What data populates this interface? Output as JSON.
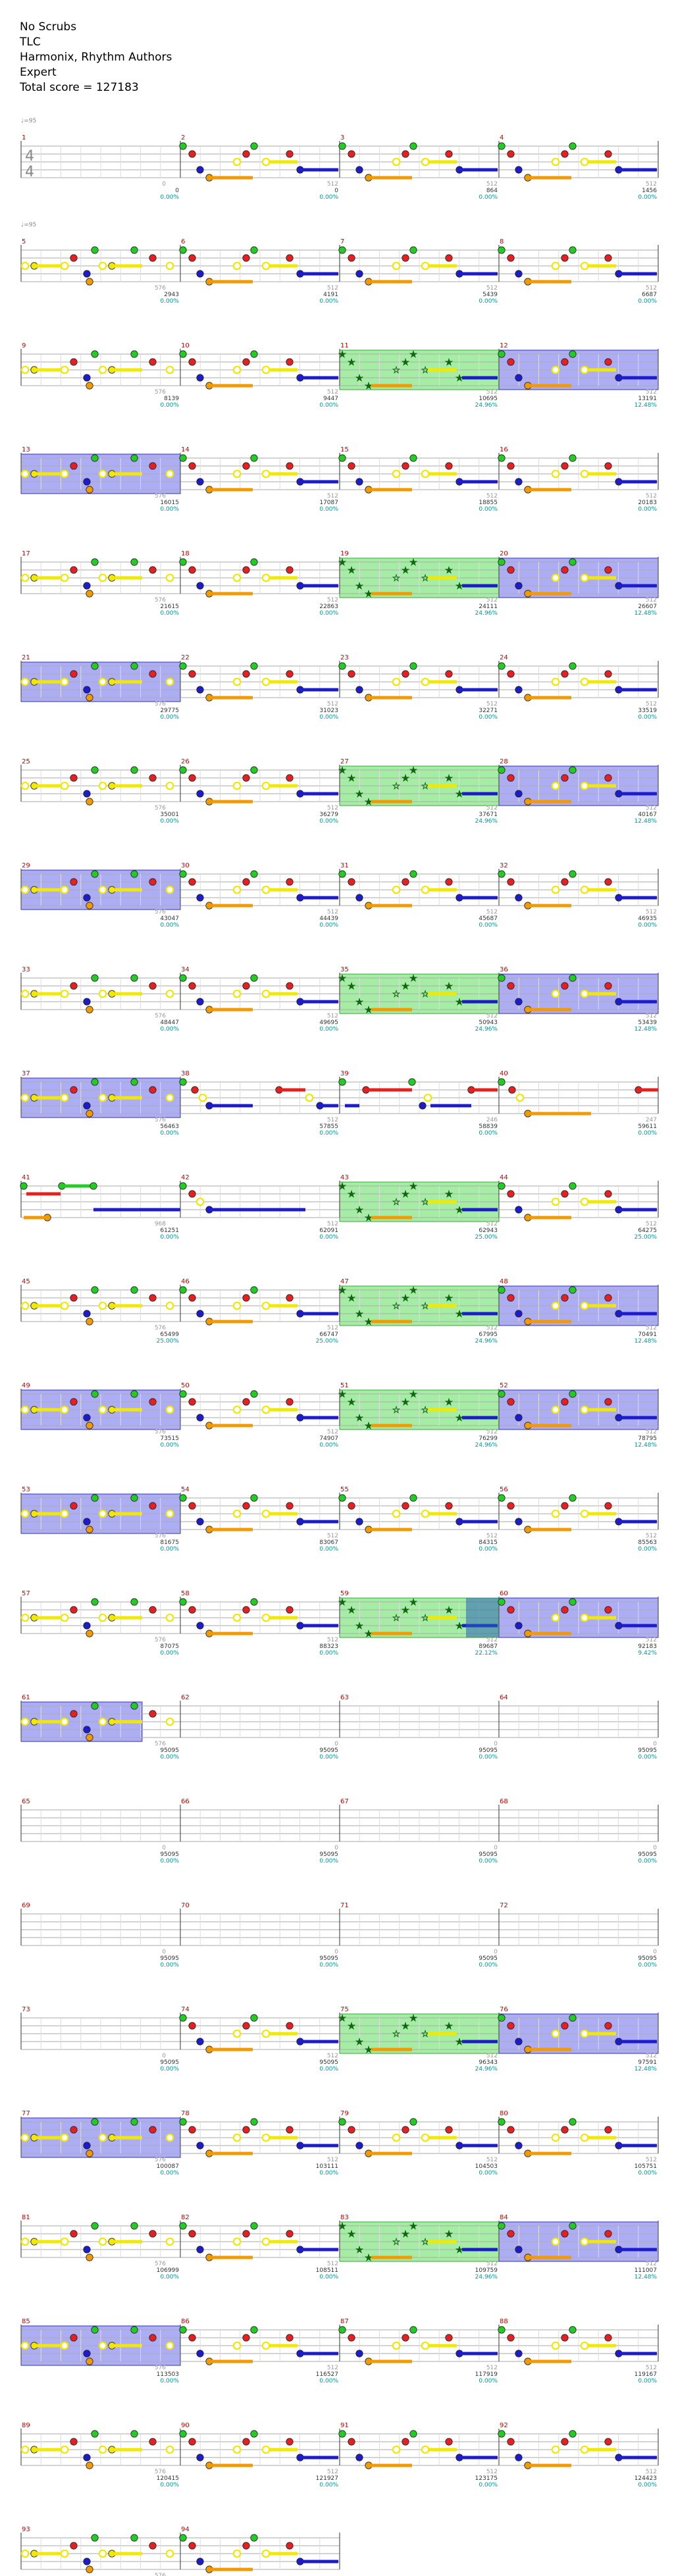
{
  "header": {
    "song_title": "No Scrubs",
    "artist": "TLC",
    "charter": "Harmonix, Rhythm Authors",
    "difficulty": "Expert",
    "total_score": "Total score = 127183"
  },
  "time_signature": "4/4",
  "tempo_markers": [
    {
      "measure": 1,
      "label": "♩=95"
    },
    {
      "measure": 5,
      "label": "♩=95"
    }
  ],
  "note_colors": {
    "green": "#22cc22",
    "red": "#e62020",
    "yellow": "#f2e800",
    "blue": "#1c1ccc",
    "orange": "#f29a00"
  },
  "measures": [
    {
      "n": 1,
      "score": "0",
      "pct": "0.00%",
      "mult": "0"
    },
    {
      "n": 2,
      "score": "0",
      "pct": "0.00%",
      "mult": "512"
    },
    {
      "n": 3,
      "score": "864",
      "pct": "0.00%",
      "mult": "512"
    },
    {
      "n": 4,
      "score": "1456",
      "pct": "0.00%",
      "mult": "512"
    },
    {
      "n": 5,
      "score": "2943",
      "pct": "0.00%",
      "mult": "576"
    },
    {
      "n": 6,
      "score": "4191",
      "pct": "0.00%",
      "mult": "512"
    },
    {
      "n": 7,
      "score": "5439",
      "pct": "0.00%",
      "mult": "512"
    },
    {
      "n": 8,
      "score": "6687",
      "pct": "0.00%",
      "mult": "512"
    },
    {
      "n": 9,
      "score": "8139",
      "pct": "0.00%",
      "mult": "576"
    },
    {
      "n": 10,
      "score": "9447",
      "pct": "0.00%",
      "mult": "512"
    },
    {
      "n": 11,
      "score": "10695",
      "pct": "24.96%",
      "mult": "512"
    },
    {
      "n": 12,
      "score": "13191",
      "pct": "12.48%",
      "mult": "512"
    },
    {
      "n": 13,
      "score": "16015",
      "pct": "0.00%",
      "mult": "576"
    },
    {
      "n": 14,
      "score": "17087",
      "pct": "0.00%",
      "mult": "512"
    },
    {
      "n": 15,
      "score": "18855",
      "pct": "0.00%",
      "mult": "512"
    },
    {
      "n": 16,
      "score": "20183",
      "pct": "0.00%",
      "mult": "512"
    },
    {
      "n": 17,
      "score": "21615",
      "pct": "0.00%",
      "mult": "576"
    },
    {
      "n": 18,
      "score": "22863",
      "pct": "0.00%",
      "mult": "512"
    },
    {
      "n": 19,
      "score": "24111",
      "pct": "24.96%",
      "mult": "512"
    },
    {
      "n": 20,
      "score": "26607",
      "pct": "12.48%",
      "mult": "512"
    },
    {
      "n": 21,
      "score": "29775",
      "pct": "0.00%",
      "mult": "576"
    },
    {
      "n": 22,
      "score": "31023",
      "pct": "0.00%",
      "mult": "512"
    },
    {
      "n": 23,
      "score": "32271",
      "pct": "0.00%",
      "mult": "512"
    },
    {
      "n": 24,
      "score": "33519",
      "pct": "0.00%",
      "mult": "512"
    },
    {
      "n": 25,
      "score": "35001",
      "pct": "0.00%",
      "mult": "576"
    },
    {
      "n": 26,
      "score": "36279",
      "pct": "0.00%",
      "mult": "512"
    },
    {
      "n": 27,
      "score": "37671",
      "pct": "24.96%",
      "mult": "512"
    },
    {
      "n": 28,
      "score": "40167",
      "pct": "12.48%",
      "mult": "512"
    },
    {
      "n": 29,
      "score": "43047",
      "pct": "0.00%",
      "mult": "576"
    },
    {
      "n": 30,
      "score": "44439",
      "pct": "0.00%",
      "mult": "512"
    },
    {
      "n": 31,
      "score": "45687",
      "pct": "0.00%",
      "mult": "512"
    },
    {
      "n": 32,
      "score": "46935",
      "pct": "0.00%",
      "mult": "512"
    },
    {
      "n": 33,
      "score": "48447",
      "pct": "0.00%",
      "mult": "576"
    },
    {
      "n": 34,
      "score": "49695",
      "pct": "0.00%",
      "mult": "512"
    },
    {
      "n": 35,
      "score": "50943",
      "pct": "24.96%",
      "mult": "512"
    },
    {
      "n": 36,
      "score": "53439",
      "pct": "12.48%",
      "mult": "512"
    },
    {
      "n": 37,
      "score": "56463",
      "pct": "0.00%",
      "mult": "576"
    },
    {
      "n": 38,
      "score": "57855",
      "pct": "0.00%",
      "mult": "512"
    },
    {
      "n": 39,
      "score": "58839",
      "pct": "0.00%",
      "mult": "246"
    },
    {
      "n": 40,
      "score": "59611",
      "pct": "0.00%",
      "mult": "247"
    },
    {
      "n": 41,
      "score": "61251",
      "pct": "0.00%",
      "mult": "968"
    },
    {
      "n": 42,
      "score": "62091",
      "pct": "0.00%",
      "mult": "512"
    },
    {
      "n": 43,
      "score": "62943",
      "pct": "25.00%",
      "mult": "512"
    },
    {
      "n": 44,
      "score": "64275",
      "pct": "25.00%",
      "mult": "512"
    },
    {
      "n": 45,
      "score": "65499",
      "pct": "25.00%",
      "mult": "576"
    },
    {
      "n": 46,
      "score": "66747",
      "pct": "25.00%",
      "mult": "512"
    },
    {
      "n": 47,
      "score": "67995",
      "pct": "24.96%",
      "mult": "512"
    },
    {
      "n": 48,
      "score": "70491",
      "pct": "12.48%",
      "mult": "512"
    },
    {
      "n": 49,
      "score": "73515",
      "pct": "0.00%",
      "mult": "576"
    },
    {
      "n": 50,
      "score": "74907",
      "pct": "0.00%",
      "mult": "512"
    },
    {
      "n": 51,
      "score": "76299",
      "pct": "24.96%",
      "mult": "512"
    },
    {
      "n": 52,
      "score": "78795",
      "pct": "12.48%",
      "mult": "512"
    },
    {
      "n": 53,
      "score": "81675",
      "pct": "0.00%",
      "mult": "576"
    },
    {
      "n": 54,
      "score": "83067",
      "pct": "0.00%",
      "mult": "512"
    },
    {
      "n": 55,
      "score": "84315",
      "pct": "0.00%",
      "mult": "512"
    },
    {
      "n": 56,
      "score": "85563",
      "pct": "0.00%",
      "mult": "512"
    },
    {
      "n": 57,
      "score": "87075",
      "pct": "0.00%",
      "mult": "576"
    },
    {
      "n": 58,
      "score": "88323",
      "pct": "0.00%",
      "mult": "512"
    },
    {
      "n": 59,
      "score": "89687",
      "pct": "22.12%",
      "mult": "512"
    },
    {
      "n": 60,
      "score": "92183",
      "pct": "9.42%",
      "mult": "512"
    },
    {
      "n": 61,
      "score": "95095",
      "pct": "0.00%",
      "mult": "576"
    },
    {
      "n": 62,
      "score": "95095",
      "pct": "0.00%",
      "mult": "0"
    },
    {
      "n": 63,
      "score": "95095",
      "pct": "0.00%",
      "mult": "0"
    },
    {
      "n": 64,
      "score": "95095",
      "pct": "0.00%",
      "mult": "0"
    },
    {
      "n": 65,
      "score": "95095",
      "pct": "0.00%",
      "mult": "0"
    },
    {
      "n": 66,
      "score": "95095",
      "pct": "0.00%",
      "mult": "0"
    },
    {
      "n": 67,
      "score": "95095",
      "pct": "0.00%",
      "mult": "0"
    },
    {
      "n": 68,
      "score": "95095",
      "pct": "0.00%",
      "mult": "0"
    },
    {
      "n": 69,
      "score": "95095",
      "pct": "0.00%",
      "mult": "0"
    },
    {
      "n": 70,
      "score": "95095",
      "pct": "0.00%",
      "mult": "0"
    },
    {
      "n": 71,
      "score": "95095",
      "pct": "0.00%",
      "mult": "0"
    },
    {
      "n": 72,
      "score": "95095",
      "pct": "0.00%",
      "mult": "0"
    },
    {
      "n": 73,
      "score": "95095",
      "pct": "0.00%",
      "mult": "0"
    },
    {
      "n": 74,
      "score": "95095",
      "pct": "0.00%",
      "mult": "512"
    },
    {
      "n": 75,
      "score": "96343",
      "pct": "24.96%",
      "mult": "512"
    },
    {
      "n": 76,
      "score": "97591",
      "pct": "12.48%",
      "mult": "512"
    },
    {
      "n": 77,
      "score": "100087",
      "pct": "0.00%",
      "mult": "576"
    },
    {
      "n": 78,
      "score": "103111",
      "pct": "0.00%",
      "mult": "512"
    },
    {
      "n": 79,
      "score": "104503",
      "pct": "0.00%",
      "mult": "512"
    },
    {
      "n": 80,
      "score": "105751",
      "pct": "0.00%",
      "mult": "512"
    },
    {
      "n": 81,
      "score": "106999",
      "pct": "0.00%",
      "mult": "576"
    },
    {
      "n": 82,
      "score": "108511",
      "pct": "0.00%",
      "mult": "512"
    },
    {
      "n": 83,
      "score": "109759",
      "pct": "24.96%",
      "mult": "512"
    },
    {
      "n": 84,
      "score": "111007",
      "pct": "12.48%",
      "mult": "512"
    },
    {
      "n": 85,
      "score": "113503",
      "pct": "0.00%",
      "mult": "576"
    },
    {
      "n": 86,
      "score": "116527",
      "pct": "0.00%",
      "mult": "512"
    },
    {
      "n": 87,
      "score": "117919",
      "pct": "0.00%",
      "mult": "512"
    },
    {
      "n": 88,
      "score": "119167",
      "pct": "0.00%",
      "mult": "512"
    },
    {
      "n": 89,
      "score": "120415",
      "pct": "0.00%",
      "mult": "576"
    },
    {
      "n": 90,
      "score": "121927",
      "pct": "0.00%",
      "mult": "512"
    },
    {
      "n": 91,
      "score": "123175",
      "pct": "0.00%",
      "mult": "512"
    },
    {
      "n": 92,
      "score": "124423",
      "pct": "0.00%",
      "mult": "512"
    },
    {
      "n": 93,
      "score": "125671",
      "pct": "0.00%",
      "mult": "576"
    },
    {
      "n": 94,
      "score": "127183",
      "pct": "0.00%",
      "mult": ""
    }
  ],
  "star_power_green_measures": [
    11,
    19,
    27,
    35,
    43,
    47,
    51,
    59,
    75,
    83
  ],
  "star_power_blue_measures": [
    12,
    13,
    20,
    21,
    28,
    29,
    36,
    37,
    48,
    49,
    52,
    53,
    60,
    61,
    76,
    77,
    84,
    85
  ],
  "empty_measures": [
    62,
    63,
    64,
    65,
    66,
    67,
    68,
    69,
    70,
    71,
    72,
    73
  ],
  "pattern_a_measures": [
    5,
    9,
    13,
    17,
    21,
    25,
    29,
    33,
    37,
    45,
    49,
    53,
    57,
    61,
    77,
    81,
    85,
    89,
    93
  ],
  "bridge_measures": [
    38,
    39,
    40,
    41,
    42
  ]
}
